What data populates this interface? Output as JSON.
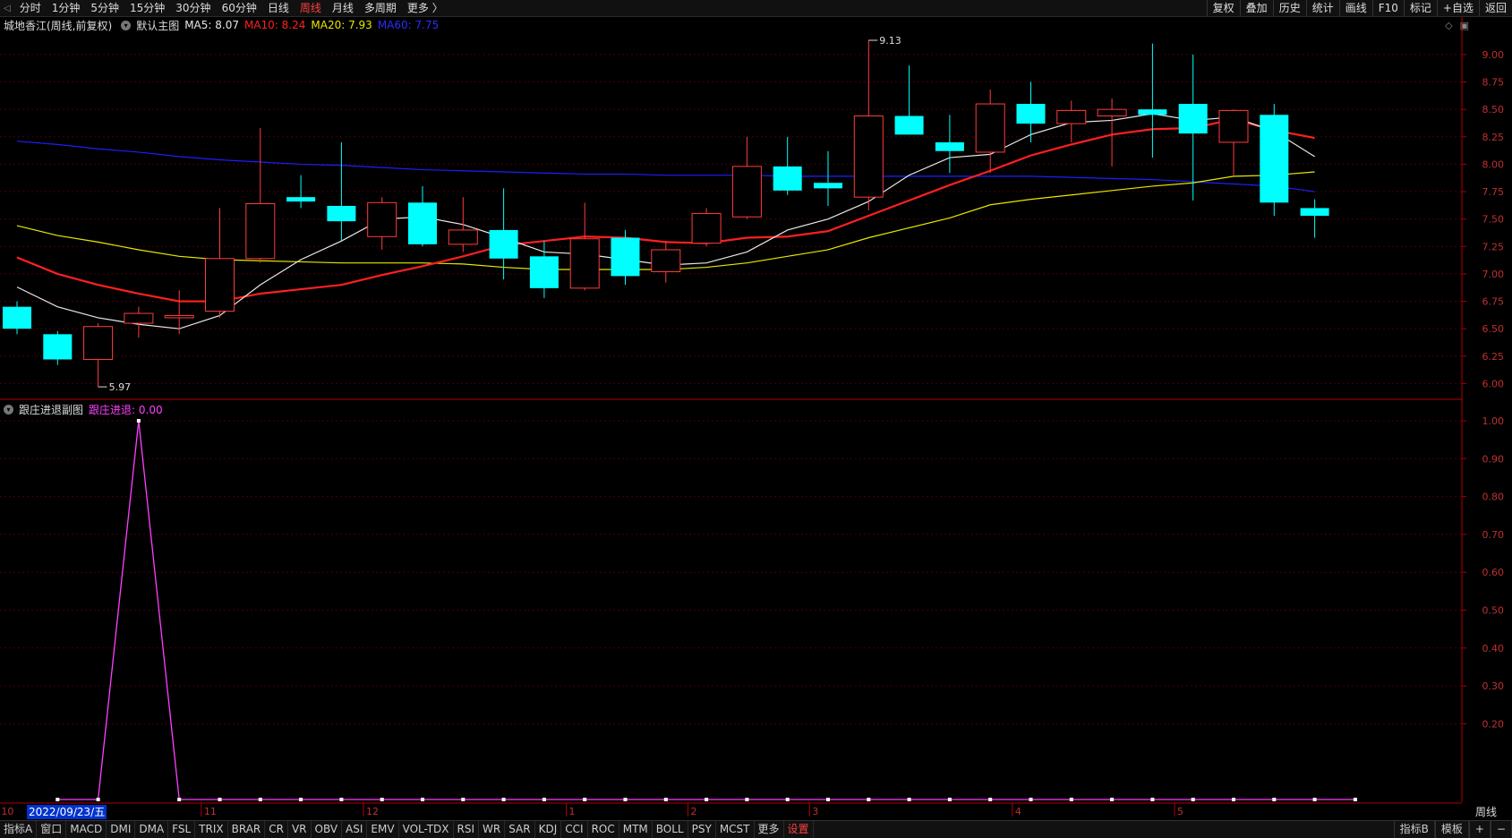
{
  "topbar": {
    "periods": [
      "分时",
      "1分钟",
      "5分钟",
      "15分钟",
      "30分钟",
      "60分钟",
      "日线",
      "周线",
      "月线",
      "多周期",
      "更多 〉"
    ],
    "active_period": "周线",
    "right_items": [
      "复权",
      "叠加",
      "历史",
      "统计",
      "画线",
      "F10",
      "标记",
      "+自选",
      "返回"
    ]
  },
  "main": {
    "title": "城地香江(周线,前复权)",
    "chart_name": "默认主图",
    "ma5_label": "MA5: 8.07",
    "ma10_label": "MA10: 8.24",
    "ma20_label": "MA20: 7.93",
    "ma60_label": "MA60: 7.75",
    "high_marker": "9.13",
    "low_marker": "5.97"
  },
  "sub": {
    "title": "跟庄进退副图",
    "value_label": "跟庄进退: 0.00"
  },
  "footer": {
    "date_tag": "2022/09/23/五",
    "period": "周线",
    "indicator_tabs": [
      "指标A",
      "窗口",
      "MACD",
      "DMI",
      "DMA",
      "FSL",
      "TRIX",
      "BRAR",
      "CR",
      "VR",
      "OBV",
      "ASI",
      "EMV",
      "VOL-TDX",
      "RSI",
      "WR",
      "SAR",
      "KDJ",
      "CCI",
      "ROC",
      "MTM",
      "BOLL",
      "PSY",
      "MCST",
      "更多",
      "设置"
    ],
    "right_tabs": [
      "指标B",
      "模板",
      "+",
      "−"
    ]
  },
  "colors": {
    "up": "#ff3c3c",
    "down": "#00ffff",
    "ma5": "#e8e8e8",
    "ma10": "#ff2020",
    "ma20": "#e8e800",
    "ma60": "#1e1eff",
    "indicator": "#ff40ff",
    "axis": "#b00000"
  },
  "chart_data": [
    {
      "type": "candlestick",
      "x_month_labels": [
        "10",
        "11",
        "12",
        "1",
        "2",
        "3",
        "4",
        "5"
      ],
      "y_ticks": [
        6.0,
        6.25,
        6.5,
        6.75,
        7.0,
        7.25,
        7.5,
        7.75,
        8.0,
        8.25,
        8.5,
        8.75,
        9.0
      ],
      "ylim": [
        5.87,
        9.28
      ],
      "ohlc": [
        [
          6.7,
          6.75,
          6.45,
          6.5
        ],
        [
          6.45,
          6.48,
          6.17,
          6.22
        ],
        [
          6.22,
          6.55,
          5.97,
          6.52
        ],
        [
          6.55,
          6.7,
          6.42,
          6.64
        ],
        [
          6.6,
          6.85,
          6.45,
          6.62
        ],
        [
          6.66,
          7.6,
          6.6,
          7.14
        ],
        [
          7.14,
          8.33,
          7.1,
          7.64
        ],
        [
          7.7,
          7.9,
          7.6,
          7.66
        ],
        [
          7.62,
          8.2,
          7.3,
          7.48
        ],
        [
          7.34,
          7.7,
          7.22,
          7.65
        ],
        [
          7.65,
          7.8,
          7.25,
          7.27
        ],
        [
          7.27,
          7.7,
          7.2,
          7.4
        ],
        [
          7.4,
          7.78,
          6.95,
          7.14
        ],
        [
          7.16,
          7.3,
          6.78,
          6.87
        ],
        [
          6.87,
          7.65,
          6.85,
          7.32
        ],
        [
          7.33,
          7.4,
          6.9,
          6.98
        ],
        [
          7.02,
          7.3,
          6.92,
          7.22
        ],
        [
          7.28,
          7.6,
          7.25,
          7.55
        ],
        [
          7.52,
          8.25,
          7.5,
          7.98
        ],
        [
          7.98,
          8.25,
          7.72,
          7.76
        ],
        [
          7.83,
          8.12,
          7.62,
          7.78
        ],
        [
          7.7,
          9.13,
          7.58,
          8.44
        ],
        [
          8.44,
          8.9,
          8.27,
          8.27
        ],
        [
          8.2,
          8.45,
          7.92,
          8.12
        ],
        [
          8.11,
          8.68,
          7.92,
          8.55
        ],
        [
          8.55,
          8.75,
          8.2,
          8.37
        ],
        [
          8.37,
          8.58,
          8.2,
          8.49
        ],
        [
          8.44,
          8.6,
          7.98,
          8.5
        ],
        [
          8.5,
          9.1,
          8.06,
          8.45
        ],
        [
          8.55,
          9.0,
          7.67,
          8.28
        ],
        [
          8.2,
          8.5,
          7.9,
          8.49
        ],
        [
          8.45,
          8.55,
          7.53,
          7.65
        ],
        [
          7.6,
          7.68,
          7.33,
          7.53
        ]
      ],
      "ma5": [
        6.88,
        6.7,
        6.6,
        6.54,
        6.5,
        6.62,
        6.9,
        7.13,
        7.3,
        7.5,
        7.52,
        7.45,
        7.33,
        7.2,
        7.18,
        7.13,
        7.08,
        7.1,
        7.2,
        7.4,
        7.5,
        7.66,
        7.9,
        8.06,
        8.09,
        8.27,
        8.38,
        8.4,
        8.46,
        8.4,
        8.43,
        8.3,
        8.07
      ],
      "ma10": [
        7.15,
        7.0,
        6.9,
        6.82,
        6.75,
        6.75,
        6.82,
        6.86,
        6.9,
        6.99,
        7.07,
        7.16,
        7.26,
        7.3,
        7.34,
        7.33,
        7.29,
        7.28,
        7.33,
        7.34,
        7.39,
        7.53,
        7.67,
        7.81,
        7.94,
        8.08,
        8.18,
        8.27,
        8.32,
        8.33,
        8.41,
        8.31,
        8.24
      ],
      "ma20": [
        7.44,
        7.35,
        7.29,
        7.22,
        7.16,
        7.13,
        7.12,
        7.11,
        7.1,
        7.1,
        7.1,
        7.09,
        7.06,
        7.04,
        7.04,
        7.04,
        7.04,
        7.06,
        7.1,
        7.16,
        7.22,
        7.33,
        7.42,
        7.51,
        7.63,
        7.68,
        7.72,
        7.76,
        7.8,
        7.83,
        7.89,
        7.9,
        7.93
      ],
      "ma60": [
        8.21,
        8.18,
        8.14,
        8.11,
        8.07,
        8.04,
        8.02,
        8.0,
        7.99,
        7.97,
        7.95,
        7.94,
        7.93,
        7.92,
        7.91,
        7.91,
        7.9,
        7.9,
        7.9,
        7.89,
        7.89,
        7.89,
        7.89,
        7.89,
        7.89,
        7.89,
        7.88,
        7.87,
        7.86,
        7.84,
        7.82,
        7.8,
        7.75
      ]
    },
    {
      "type": "line",
      "name": "跟庄进退",
      "y_ticks": [
        0.2,
        0.3,
        0.4,
        0.5,
        0.6,
        0.7,
        0.8,
        0.9,
        1.0
      ],
      "ylim": [
        0.0,
        1.0
      ],
      "values": [
        0,
        0,
        1,
        0,
        0,
        0,
        0,
        0,
        0,
        0,
        0,
        0,
        0,
        0,
        0,
        0,
        0,
        0,
        0,
        0,
        0,
        0,
        0,
        0,
        0,
        0,
        0,
        0,
        0,
        0,
        0,
        0,
        0
      ]
    }
  ]
}
